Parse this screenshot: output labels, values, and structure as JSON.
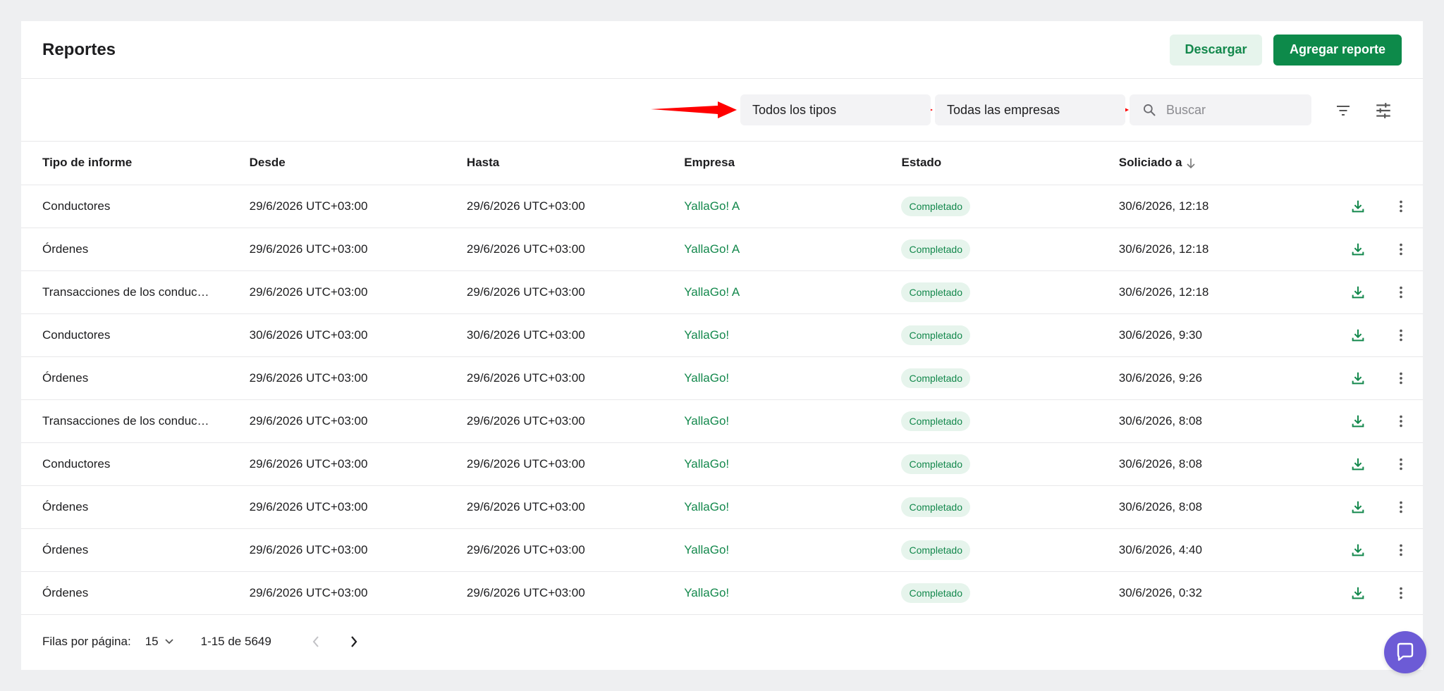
{
  "header": {
    "title": "Reportes",
    "download_label": "Descargar",
    "add_label": "Agregar reporte"
  },
  "filters": {
    "type_select": "Todos los tipos",
    "company_select": "Todas las empresas",
    "search_placeholder": "Buscar"
  },
  "table": {
    "columns": [
      "Tipo de informe",
      "Desde",
      "Hasta",
      "Empresa",
      "Estado",
      "Soliciado a"
    ],
    "rows": [
      {
        "type": "Conductores",
        "from": "29/6/2026 UTC+03:00",
        "to": "29/6/2026 UTC+03:00",
        "company": "YallaGo! A",
        "status": "Completado",
        "requested": "30/6/2026, 12:18"
      },
      {
        "type": "Órdenes",
        "from": "29/6/2026 UTC+03:00",
        "to": "29/6/2026 UTC+03:00",
        "company": "YallaGo! A",
        "status": "Completado",
        "requested": "30/6/2026, 12:18"
      },
      {
        "type": "Transacciones de los conduc…",
        "from": "29/6/2026 UTC+03:00",
        "to": "29/6/2026 UTC+03:00",
        "company": "YallaGo! A",
        "status": "Completado",
        "requested": "30/6/2026, 12:18"
      },
      {
        "type": "Conductores",
        "from": "30/6/2026 UTC+03:00",
        "to": "30/6/2026 UTC+03:00",
        "company": "YallaGo!",
        "status": "Completado",
        "requested": "30/6/2026, 9:30"
      },
      {
        "type": "Órdenes",
        "from": "29/6/2026 UTC+03:00",
        "to": "29/6/2026 UTC+03:00",
        "company": "YallaGo!",
        "status": "Completado",
        "requested": "30/6/2026, 9:26"
      },
      {
        "type": "Transacciones de los conduc…",
        "from": "29/6/2026 UTC+03:00",
        "to": "29/6/2026 UTC+03:00",
        "company": "YallaGo!",
        "status": "Completado",
        "requested": "30/6/2026, 8:08"
      },
      {
        "type": "Conductores",
        "from": "29/6/2026 UTC+03:00",
        "to": "29/6/2026 UTC+03:00",
        "company": "YallaGo!",
        "status": "Completado",
        "requested": "30/6/2026, 8:08"
      },
      {
        "type": "Órdenes",
        "from": "29/6/2026 UTC+03:00",
        "to": "29/6/2026 UTC+03:00",
        "company": "YallaGo!",
        "status": "Completado",
        "requested": "30/6/2026, 8:08"
      },
      {
        "type": "Órdenes",
        "from": "29/6/2026 UTC+03:00",
        "to": "29/6/2026 UTC+03:00",
        "company": "YallaGo!",
        "status": "Completado",
        "requested": "30/6/2026, 4:40"
      },
      {
        "type": "Órdenes",
        "from": "29/6/2026 UTC+03:00",
        "to": "29/6/2026 UTC+03:00",
        "company": "YallaGo!",
        "status": "Completado",
        "requested": "30/6/2026, 0:32"
      }
    ]
  },
  "footer": {
    "rows_per_page_label": "Filas por página:",
    "rows_per_page_value": "15",
    "range": "1-15 de 5649"
  },
  "icons": {
    "search": "search-icon",
    "filter": "filter-icon",
    "settings": "sliders-icon",
    "download": "download-icon",
    "more": "more-vertical-icon",
    "sort": "arrow-down-icon",
    "chat": "chat-icon",
    "annotation": "red-arrow-icon"
  },
  "colors": {
    "accent": "#0d8a4a",
    "accent_light": "#e6f4ec",
    "annotation_arrow": "#ff0000",
    "chat": "#6c5bd6"
  }
}
